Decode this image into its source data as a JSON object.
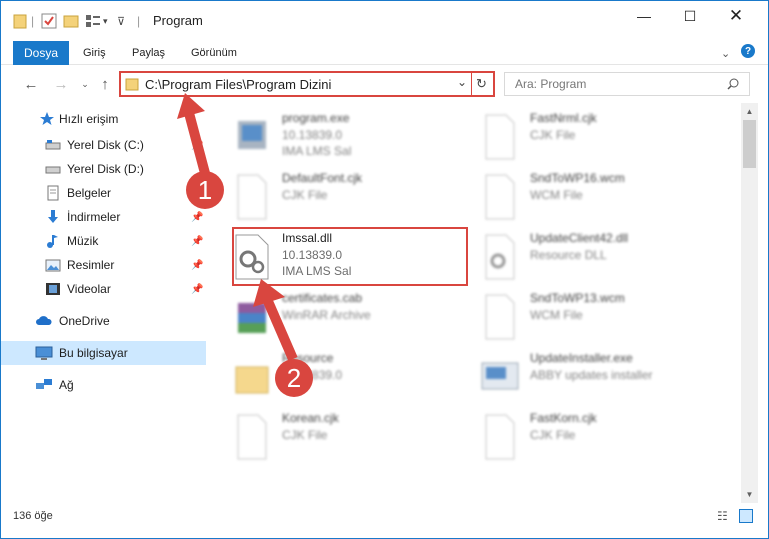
{
  "window": {
    "title": "Program",
    "minimize_icon": "minimize-icon",
    "maximize_icon": "maximize-icon",
    "close_icon": "close-icon"
  },
  "ribbon": {
    "tabs": [
      "Dosya",
      "Giriş",
      "Paylaş",
      "Görünüm"
    ]
  },
  "nav": {
    "address": "C:\\Program Files\\Program Dizini",
    "search_placeholder": "Ara: Program"
  },
  "sidebar": {
    "items": [
      {
        "label": "Hızlı erişim",
        "icon": "star-icon"
      },
      {
        "label": "Yerel Disk (C:)",
        "icon": "drive-icon"
      },
      {
        "label": "Yerel Disk (D:)",
        "icon": "drive-icon"
      },
      {
        "label": "Belgeler",
        "icon": "document-icon"
      },
      {
        "label": "İndirmeler",
        "icon": "download-icon"
      },
      {
        "label": "Müzik",
        "icon": "music-icon"
      },
      {
        "label": "Resimler",
        "icon": "pictures-icon"
      },
      {
        "label": "Videolar",
        "icon": "video-icon"
      },
      {
        "label": "OneDrive",
        "icon": "cloud-icon"
      },
      {
        "label": "Bu bilgisayar",
        "icon": "computer-icon"
      },
      {
        "label": "Ağ",
        "icon": "network-icon"
      }
    ]
  },
  "files": [
    {
      "name": "program.exe",
      "line2": "10.13839.0",
      "line3": "IMA LMS Sal"
    },
    {
      "name": "FastNrml.cjk",
      "line2": "CJK File",
      "line3": ""
    },
    {
      "name": "DefaultFont.cjk",
      "line2": "CJK File",
      "line3": ""
    },
    {
      "name": "SndToWP16.wcm",
      "line2": "WCM File",
      "line3": ""
    },
    {
      "name": "Imssal.dll",
      "line2": "10.13839.0",
      "line3": "IMA LMS Sal"
    },
    {
      "name": "UpdateClient42.dll",
      "line2": "Resource DLL",
      "line3": ""
    },
    {
      "name": "certificates.cab",
      "line2": "WinRAR Archive",
      "line3": ""
    },
    {
      "name": "SndToWP13.wcm",
      "line2": "WCM File",
      "line3": ""
    },
    {
      "name": "Resource",
      "line2": "10.13839.0",
      "line3": ""
    },
    {
      "name": "UpdateInstaller.exe",
      "line2": "ABBY updates installer",
      "line3": ""
    },
    {
      "name": "Korean.cjk",
      "line2": "CJK File",
      "line3": ""
    },
    {
      "name": "FastKorn.cjk",
      "line2": "CJK File",
      "line3": ""
    }
  ],
  "status": {
    "count": "136 öğe"
  },
  "annotations": {
    "step1": "1",
    "step2": "2",
    "color": "#d9463f"
  }
}
